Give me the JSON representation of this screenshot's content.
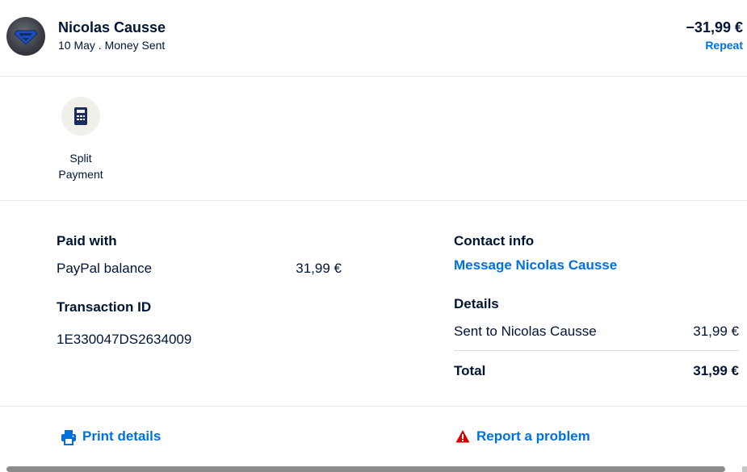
{
  "header": {
    "name": "Nicolas Causse",
    "subline": "10 May . Money Sent",
    "amount": "−31,99 €",
    "repeat_label": "Repeat"
  },
  "split": {
    "label_line1": "Split",
    "label_line2": "Payment",
    "icon": "calculator-icon"
  },
  "paid_with": {
    "heading": "Paid with",
    "method": "PayPal balance",
    "amount": "31,99 €"
  },
  "transaction": {
    "heading": "Transaction ID",
    "id": "1E330047DS2634009"
  },
  "contact": {
    "heading": "Contact info",
    "message_link": "Message Nicolas Causse"
  },
  "details": {
    "heading": "Details",
    "sent_to": "Sent to Nicolas Causse",
    "sent_amount": "31,99 €",
    "total_label": "Total",
    "total_amount": "31,99 €"
  },
  "actions": {
    "print_label": "Print details",
    "report_label": "Report a problem"
  },
  "colors": {
    "link": "#0070e0",
    "text": "#001435",
    "warning": "#d20000",
    "divider": "#ebe8e2"
  }
}
